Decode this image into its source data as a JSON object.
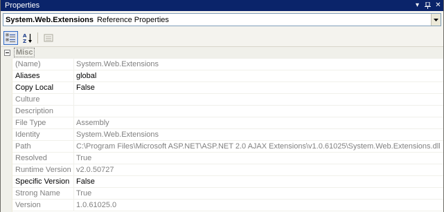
{
  "window": {
    "title": "Properties",
    "buttons": {
      "dropdown_glyph": "▾",
      "pin_glyph": "⊥",
      "close_glyph": "✕"
    }
  },
  "object_selector": {
    "name": "System.Web.Extensions",
    "type": "Reference Properties"
  },
  "toolbar": {
    "buttons": [
      {
        "name": "categorized",
        "icon": "categorized-icon",
        "pressed": true
      },
      {
        "name": "alphabetical",
        "icon": "alphabetical-icon",
        "pressed": false
      },
      {
        "name": "property-pages",
        "icon": "property-pages-icon",
        "pressed": false
      }
    ]
  },
  "grid": {
    "category": "Misc",
    "properties": [
      {
        "name": "(Name)",
        "value": "System.Web.Extensions",
        "readonly": true
      },
      {
        "name": "Aliases",
        "value": "global",
        "readonly": false
      },
      {
        "name": "Copy Local",
        "value": "False",
        "readonly": false
      },
      {
        "name": "Culture",
        "value": "",
        "readonly": true
      },
      {
        "name": "Description",
        "value": "",
        "readonly": true
      },
      {
        "name": "File Type",
        "value": "Assembly",
        "readonly": true
      },
      {
        "name": "Identity",
        "value": "System.Web.Extensions",
        "readonly": true
      },
      {
        "name": "Path",
        "value": "C:\\Program Files\\Microsoft ASP.NET\\ASP.NET 2.0 AJAX Extensions\\v1.0.61025\\System.Web.Extensions.dll",
        "readonly": true
      },
      {
        "name": "Resolved",
        "value": "True",
        "readonly": true
      },
      {
        "name": "Runtime Version",
        "value": "v2.0.50727",
        "readonly": true
      },
      {
        "name": "Specific Version",
        "value": "False",
        "readonly": false
      },
      {
        "name": "Strong Name",
        "value": "True",
        "readonly": true
      },
      {
        "name": "Version",
        "value": "1.0.61025.0",
        "readonly": true
      }
    ]
  },
  "colors": {
    "titlebar": "#0a246a",
    "readonly_text": "#808080",
    "grid_margin": "#f0f0ea"
  }
}
